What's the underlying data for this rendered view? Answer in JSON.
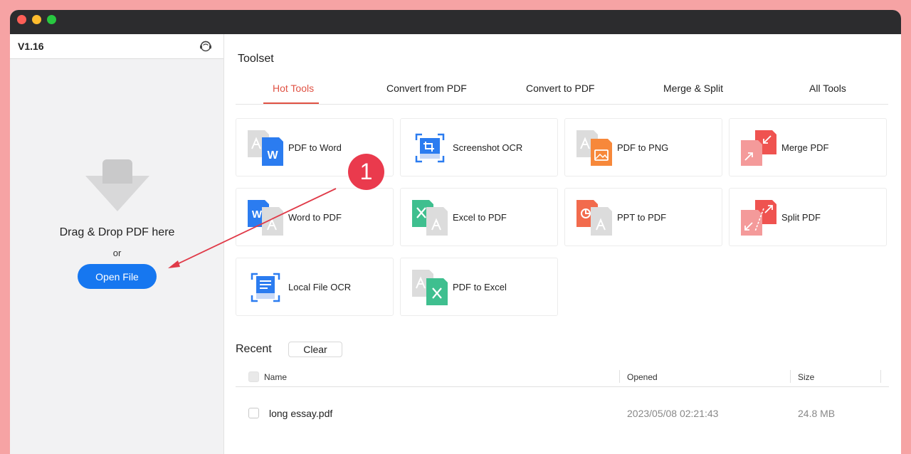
{
  "sidebar": {
    "version": "V1.16",
    "drop_text": "Drag & Drop PDF here",
    "or_text": "or",
    "open_label": "Open File"
  },
  "main": {
    "section_title": "Toolset",
    "tabs": [
      {
        "label": "Hot Tools",
        "active": true
      },
      {
        "label": "Convert from PDF"
      },
      {
        "label": "Convert to PDF"
      },
      {
        "label": "Merge & Split"
      },
      {
        "label": "All Tools"
      }
    ],
    "tools": [
      {
        "label": "PDF to Word",
        "icon": "pdf-to-word-icon"
      },
      {
        "label": "Screenshot OCR",
        "icon": "screenshot-ocr-icon"
      },
      {
        "label": "PDF to PNG",
        "icon": "pdf-to-png-icon"
      },
      {
        "label": "Merge PDF",
        "icon": "merge-pdf-icon"
      },
      {
        "label": "Word to PDF",
        "icon": "word-to-pdf-icon"
      },
      {
        "label": "Excel to PDF",
        "icon": "excel-to-pdf-icon"
      },
      {
        "label": "PPT to PDF",
        "icon": "ppt-to-pdf-icon"
      },
      {
        "label": "Split PDF",
        "icon": "split-pdf-icon"
      },
      {
        "label": "Local File OCR",
        "icon": "local-file-ocr-icon"
      },
      {
        "label": "PDF to Excel",
        "icon": "pdf-to-excel-icon"
      }
    ]
  },
  "recent": {
    "title": "Recent",
    "clear_label": "Clear",
    "columns": {
      "name": "Name",
      "opened": "Opened",
      "size": "Size"
    },
    "rows": [
      {
        "name": "long essay.pdf",
        "opened": "2023/05/08 02:21:43",
        "size": "24.8 MB"
      }
    ]
  },
  "annotation": {
    "number": "1"
  },
  "colors": {
    "accent": "#e05244",
    "primary_button": "#1677f0",
    "word_blue": "#2b7cf0",
    "excel_green": "#3fbf8f",
    "pdf_red": "#ef5350",
    "png_orange": "#f7883a",
    "annotation_red": "#ea3a4d",
    "page_border": "#f6a3a4"
  }
}
